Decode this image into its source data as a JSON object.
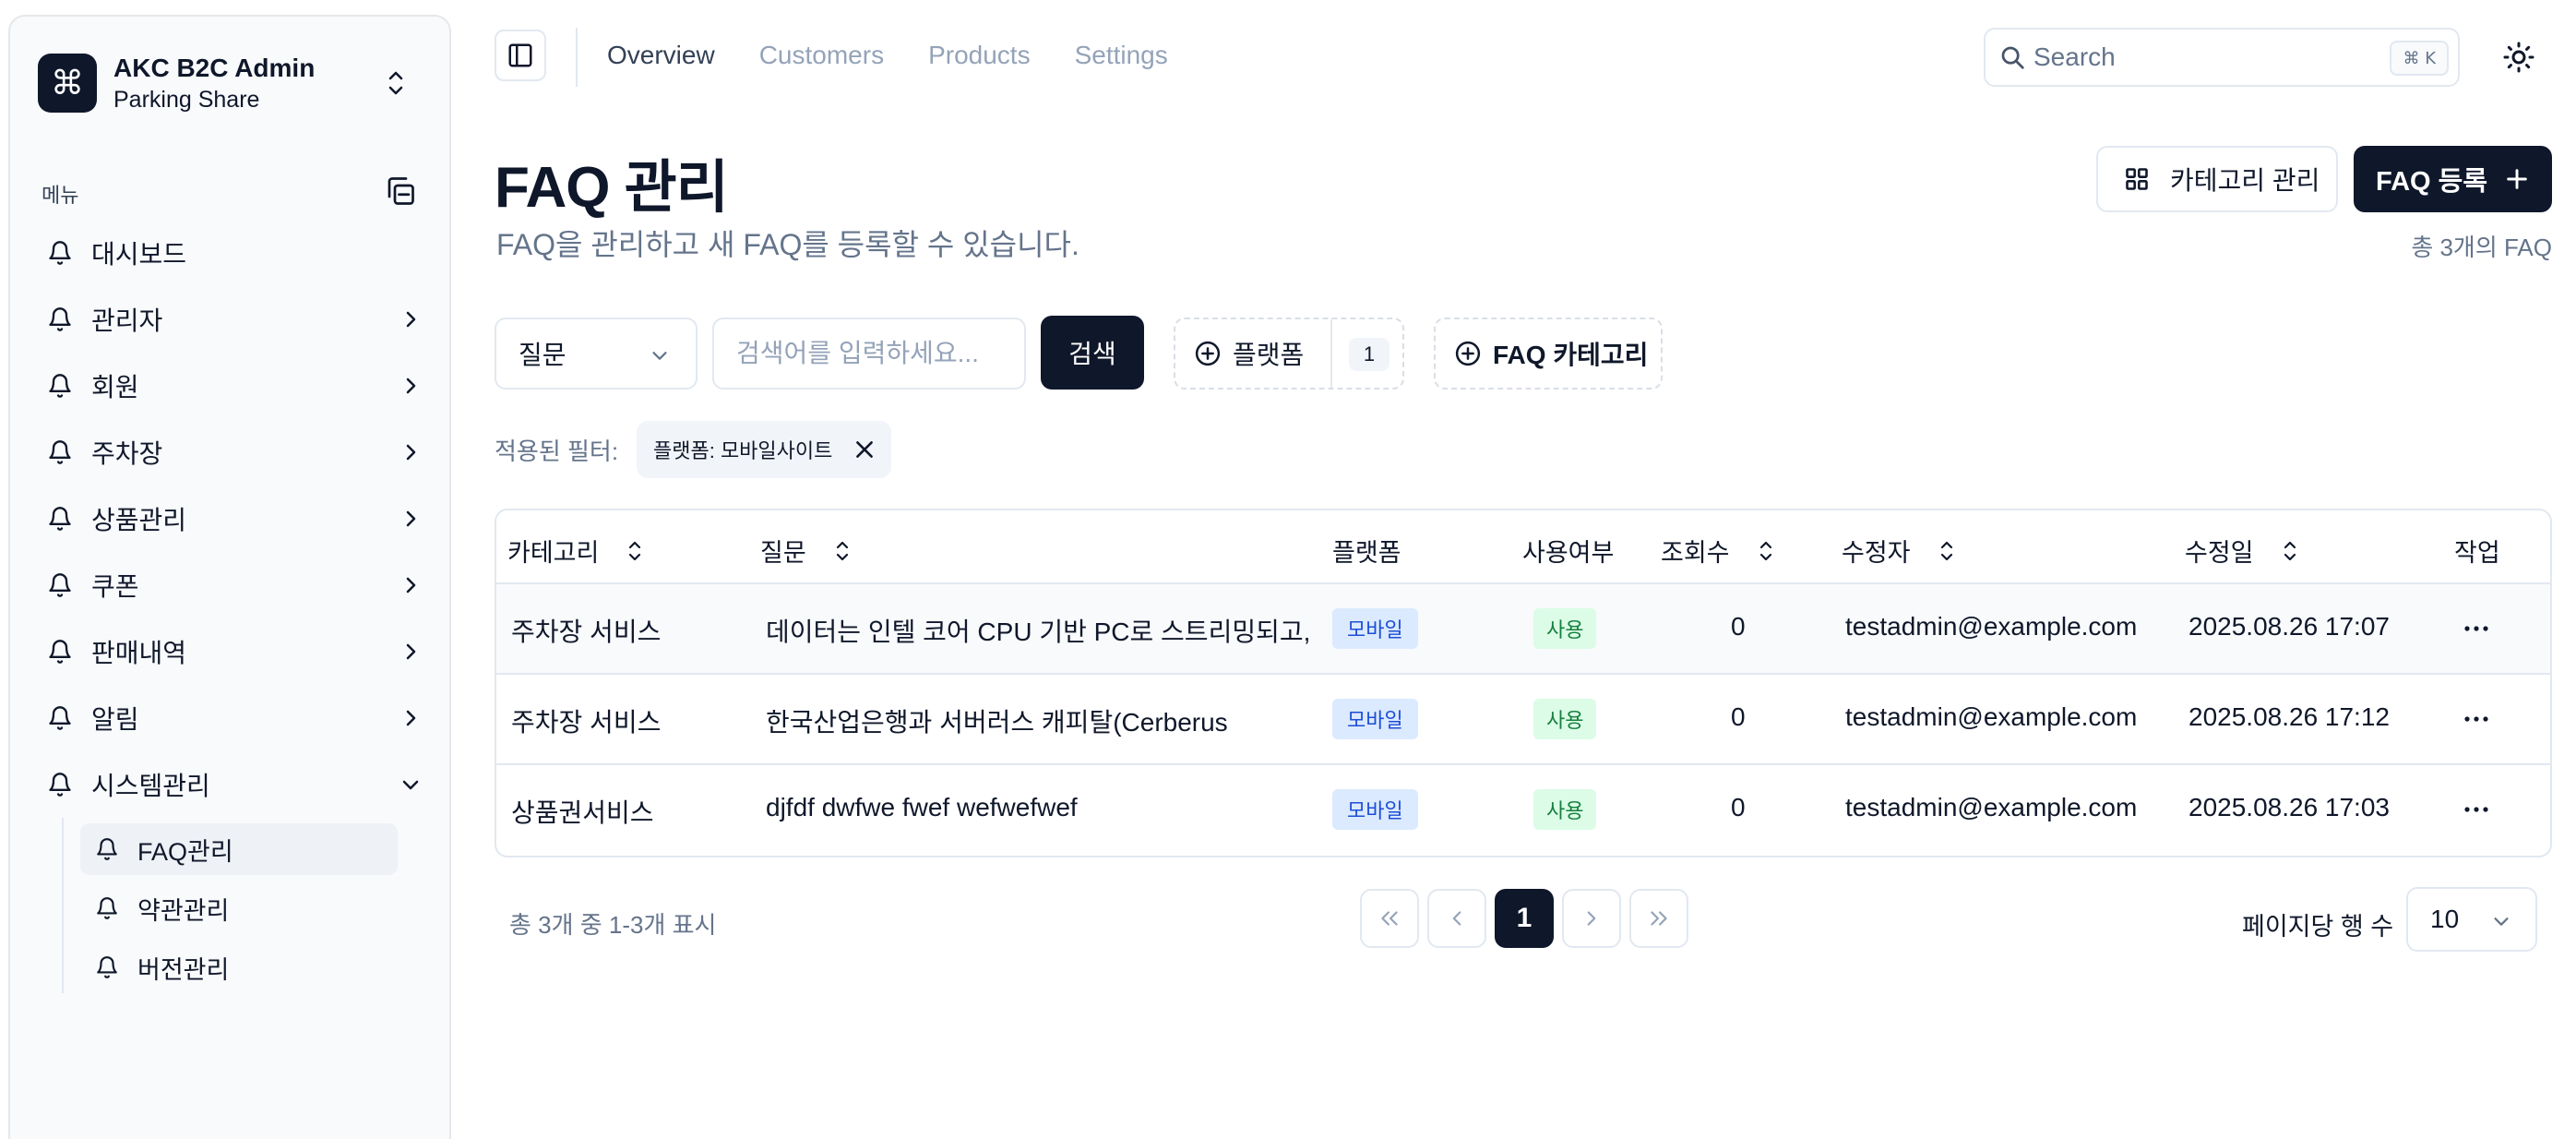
{
  "brand": {
    "title": "AKC B2C Admin",
    "subtitle": "Parking Share",
    "logo_glyph": "⌘"
  },
  "sidebar": {
    "section_label": "메뉴",
    "items": [
      {
        "label": "대시보드",
        "icon": "bell-icon",
        "has_chevron": false
      },
      {
        "label": "관리자",
        "icon": "bell-icon",
        "has_chevron": true
      },
      {
        "label": "회원",
        "icon": "bell-icon",
        "has_chevron": true
      },
      {
        "label": "주차장",
        "icon": "bell-icon",
        "has_chevron": true
      },
      {
        "label": "상품관리",
        "icon": "bell-icon",
        "has_chevron": true
      },
      {
        "label": "쿠폰",
        "icon": "bell-icon",
        "has_chevron": true
      },
      {
        "label": "판매내역",
        "icon": "bell-icon",
        "has_chevron": true
      },
      {
        "label": "알림",
        "icon": "bell-icon",
        "has_chevron": true
      },
      {
        "label": "시스템관리",
        "icon": "bell-icon",
        "has_chevron": true,
        "expanded": true
      }
    ],
    "subitems": [
      {
        "label": "FAQ관리",
        "active": true
      },
      {
        "label": "약관관리",
        "active": false
      },
      {
        "label": "버전관리",
        "active": false
      }
    ]
  },
  "topnav": {
    "tabs": [
      {
        "label": "Overview",
        "active": true
      },
      {
        "label": "Customers",
        "active": false
      },
      {
        "label": "Products",
        "active": false
      },
      {
        "label": "Settings",
        "active": false
      }
    ],
    "search_placeholder": "Search",
    "search_shortcut": "⌘ K"
  },
  "page": {
    "title": "FAQ 관리",
    "subtitle": "FAQ을 관리하고 새 FAQ를 등록할 수 있습니다.",
    "category_button": "카테고리 관리",
    "register_button": "FAQ 등록",
    "total_count": "총 3개의 FAQ"
  },
  "filters": {
    "field_select": "질문",
    "search_placeholder": "검색어를 입력하세요...",
    "search_button": "검색",
    "platform_facet": "플랫폼",
    "platform_count": "1",
    "category_facet": "FAQ 카테고리",
    "applied_label": "적용된 필터:",
    "applied_chip": "플랫폼: 모바일사이트"
  },
  "table": {
    "headers": {
      "category": "카테고리",
      "question": "질문",
      "platform": "플랫폼",
      "use": "사용여부",
      "views": "조회수",
      "editor": "수정자",
      "date": "수정일",
      "action": "작업"
    },
    "rows": [
      {
        "category": "주차장 서비스",
        "question": "데이터는 인텔 코어 CPU 기반 PC로 스트리밍되고,",
        "platform": "모바일",
        "use": "사용",
        "views": "0",
        "editor": "testadmin@example.com",
        "date": "2025.08.26 17:07"
      },
      {
        "category": "주차장 서비스",
        "question": "한국산업은행과 서버러스 캐피탈(Cerberus",
        "platform": "모바일",
        "use": "사용",
        "views": "0",
        "editor": "testadmin@example.com",
        "date": "2025.08.26 17:12"
      },
      {
        "category": "상품권서비스",
        "question": "djfdf dwfwe fwef wefwefwef",
        "platform": "모바일",
        "use": "사용",
        "views": "0",
        "editor": "testadmin@example.com",
        "date": "2025.08.26 17:03"
      }
    ]
  },
  "pagination": {
    "info": "총 3개 중 1-3개 표시",
    "current_page": "1",
    "rows_per_page_label": "페이지당 행 수",
    "rows_per_page_value": "10"
  },
  "colors": {
    "primary": "#0f172a",
    "muted": "#64748b",
    "border": "#e2e8f0",
    "badge_blue": "#dbeafe",
    "badge_green": "#dcfce7"
  }
}
